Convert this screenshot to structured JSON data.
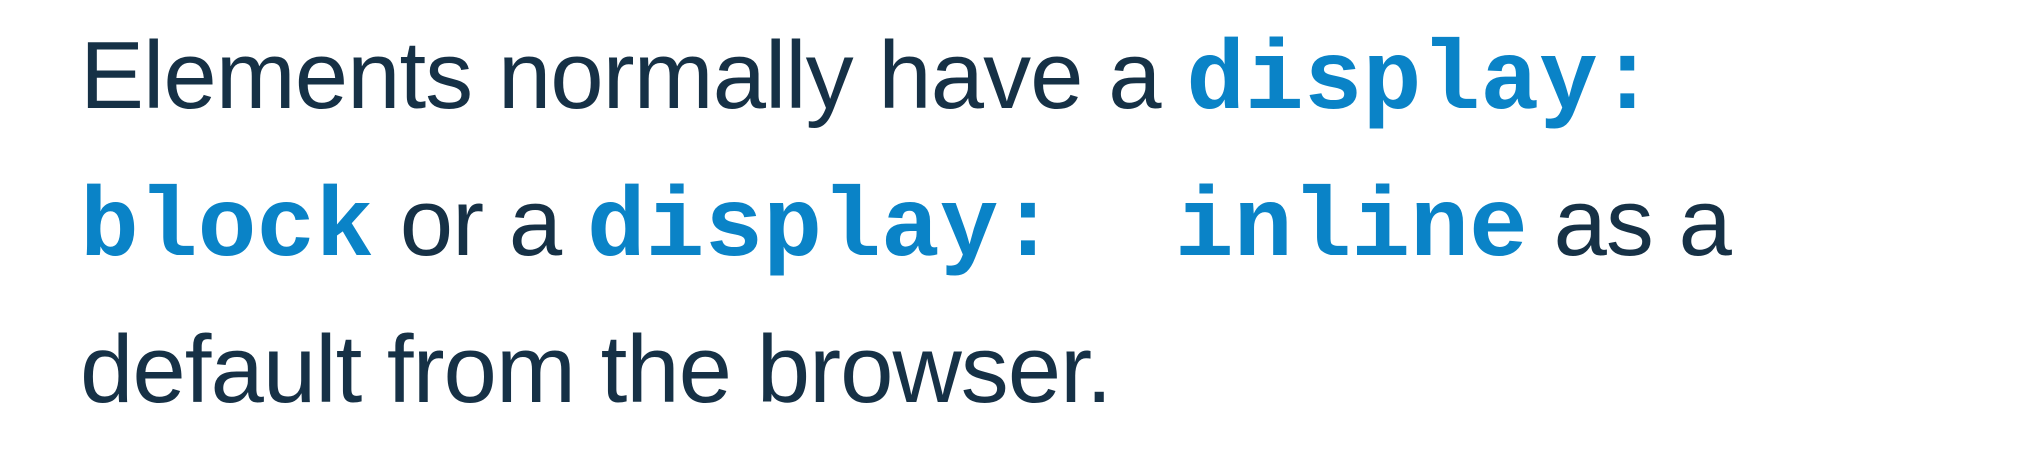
{
  "text": {
    "line1_prefix": "Elements normally have a ",
    "line1_code": "display:",
    "line2_code1": "block",
    "line2_mid": " or a ",
    "line2_code2": "display:  inline",
    "line2_suffix": " as a",
    "line3": "default from the browser."
  },
  "colors": {
    "text": "#163146",
    "code": "#0a83c7",
    "background": "#ffffff"
  }
}
